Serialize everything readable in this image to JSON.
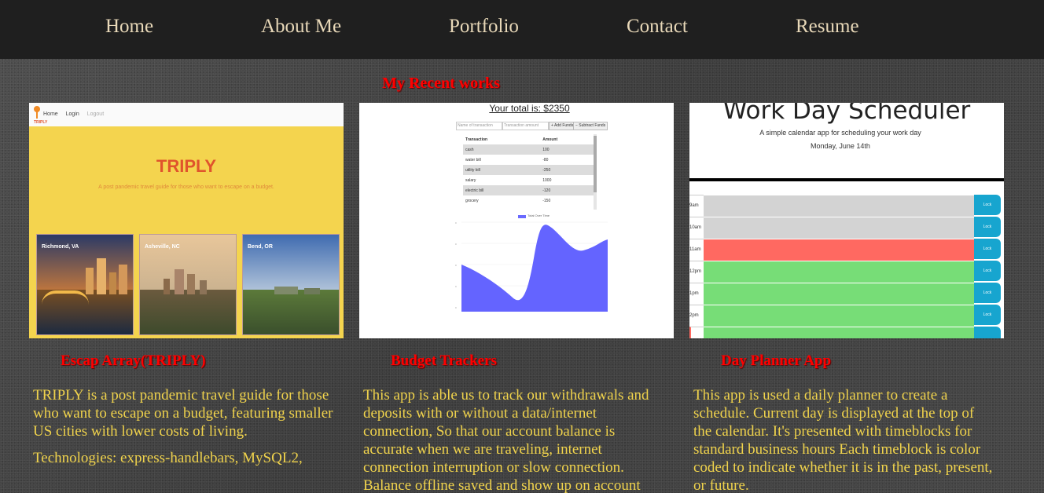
{
  "nav": {
    "items": [
      "Home",
      "About Me",
      "Portfolio",
      "Contact",
      "Resume"
    ]
  },
  "section_title": "My Recent works",
  "cards": [
    {
      "title": "Escap Array(TRIPLY)",
      "desc": [
        "TRIPLY is a post pandemic travel guide for those who want to escape on a budget, featuring smaller US cities with lower costs of living.",
        "Technologies: express-handlebars, MySQL2,"
      ],
      "thumb": {
        "nav": [
          "Home",
          "Login",
          "Logout"
        ],
        "logo_text": "TRIPLY",
        "brand": "TRIPLY",
        "tagline": "A post pandemic travel guide for those who want to escape on a budget.",
        "cities": [
          "Richmond, VA",
          "Asheville, NC",
          "Bend, OR"
        ]
      }
    },
    {
      "title": "Budget Trackers",
      "desc": [
        "This app is able us to track our withdrawals and deposits with or without a data/internet connection, So that our account balance is accurate when we are traveling, internet connection interruption or slow connection. Balance offline saved and show up on account"
      ],
      "thumb": {
        "total": "Your total is: $2350",
        "name_placeholder": "Name of transaction",
        "amount_placeholder": "Transaction amount",
        "add_btn": "+ Add Funds",
        "sub_btn": "− Subtract Funds",
        "columns": [
          "Transaction",
          "Amount"
        ],
        "rows": [
          [
            "cash",
            "100"
          ],
          [
            "water bill",
            "-80"
          ],
          [
            "utility bill",
            "-250"
          ],
          [
            "salary",
            "1000"
          ],
          [
            "electric bill",
            "-120"
          ],
          [
            "grocery",
            "-150"
          ]
        ],
        "legend": "Total Over Time"
      }
    },
    {
      "title": "Day Planner App",
      "desc": [
        "This app is used a daily planner to create a schedule. Current day is displayed at the top of the calendar. It's presented with timeblocks for standard business hours Each timeblock is color coded to indicate whether it is in the past, present, or future."
      ],
      "thumb": {
        "heading": "Work Day Scheduler",
        "subheading": "A simple calendar app for scheduling your work day",
        "date": "Monday, June 14th",
        "hours": [
          "9am",
          "10am",
          "11am",
          "12pm",
          "1pm",
          "2pm"
        ],
        "states": [
          "past",
          "past",
          "present",
          "future",
          "future",
          "future"
        ],
        "lock_label": "Lock"
      }
    }
  ],
  "colors": {
    "nav_bg": "#1f1f1f",
    "nav_text": "#e8d8b8",
    "title_red": "#ff0000",
    "desc_yellow": "#f0d34c",
    "past": "#d3d3d3",
    "present": "#ff6961",
    "future": "#77dd77",
    "lock": "#17a5cf"
  }
}
